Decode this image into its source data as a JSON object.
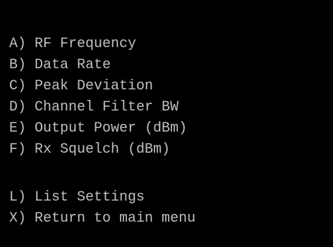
{
  "menu": {
    "group1": [
      {
        "key": "A",
        "label": "RF Frequency"
      },
      {
        "key": "B",
        "label": "Data Rate"
      },
      {
        "key": "C",
        "label": "Peak Deviation"
      },
      {
        "key": "D",
        "label": "Channel Filter BW"
      },
      {
        "key": "E",
        "label": "Output Power (dBm)"
      },
      {
        "key": "F",
        "label": "Rx Squelch (dBm)"
      }
    ],
    "group2": [
      {
        "key": "L",
        "label": "List Settings"
      },
      {
        "key": "X",
        "label": "Return to main menu"
      }
    ]
  },
  "colors": {
    "background": "#000000",
    "text": "#c0c0c0"
  }
}
